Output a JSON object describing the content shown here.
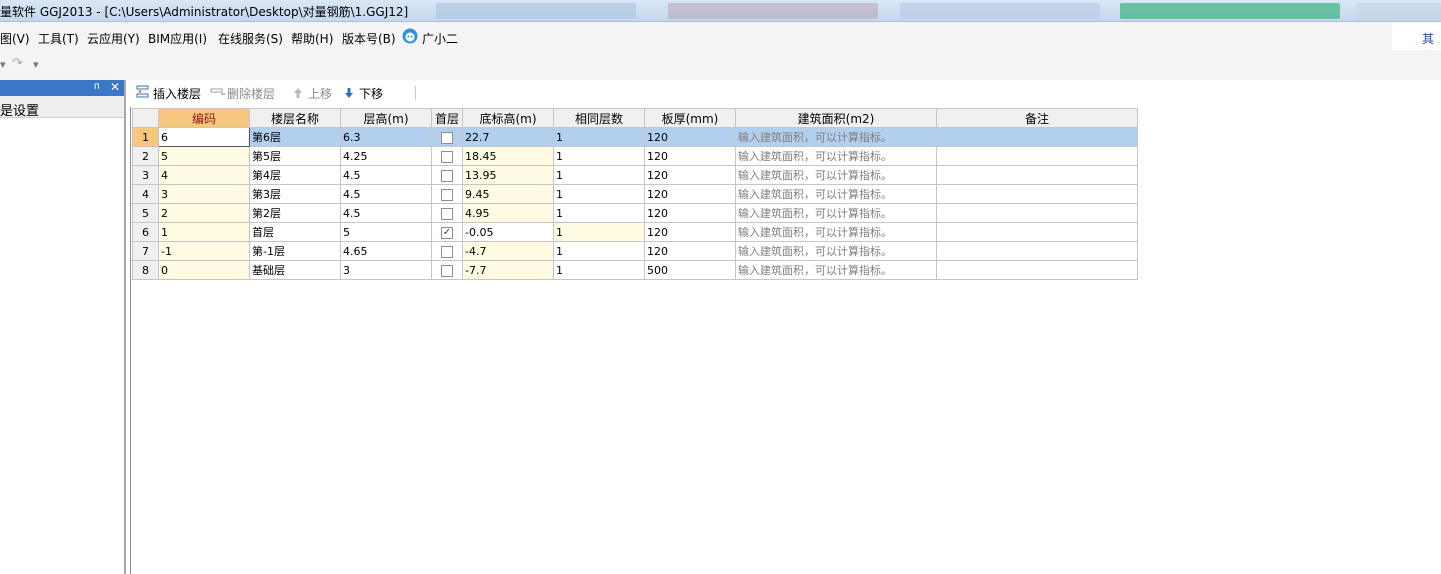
{
  "window": {
    "title": "量软件 GGJ2013 - [C:\\Users\\Administrator\\Desktop\\对量钢筋\\1.GGJ12]"
  },
  "menu": {
    "items": [
      {
        "label": "图(V)"
      },
      {
        "label": "工具(T)"
      },
      {
        "label": "云应用(Y)"
      },
      {
        "label": "BIM应用(I)"
      },
      {
        "label": "在线服务(S)"
      },
      {
        "label": "帮助(H)"
      },
      {
        "label": "版本号(B)"
      },
      {
        "label": "广小二"
      }
    ],
    "right_label": "其它"
  },
  "left_panel": {
    "tab_label": "是设置"
  },
  "toolbar": {
    "insert_floor": "插入楼层",
    "delete_floor": "删除楼层",
    "move_up": "上移",
    "move_down": "下移"
  },
  "grid": {
    "headers": [
      "编码",
      "楼层名称",
      "层高(m)",
      "首层",
      "底标高(m)",
      "相同层数",
      "板厚(mm)",
      "建筑面积(m2)",
      "备注"
    ],
    "rows": [
      {
        "num": "1",
        "code": "6",
        "name": "第6层",
        "height": "6.3",
        "first": false,
        "bottom": "22.7",
        "same": "1",
        "thick": "120",
        "area": "输入建筑面积，可以计算指标。",
        "note": ""
      },
      {
        "num": "2",
        "code": "5",
        "name": "第5层",
        "height": "4.25",
        "first": false,
        "bottom": "18.45",
        "same": "1",
        "thick": "120",
        "area": "输入建筑面积，可以计算指标。",
        "note": ""
      },
      {
        "num": "3",
        "code": "4",
        "name": "第4层",
        "height": "4.5",
        "first": false,
        "bottom": "13.95",
        "same": "1",
        "thick": "120",
        "area": "输入建筑面积，可以计算指标。",
        "note": ""
      },
      {
        "num": "4",
        "code": "3",
        "name": "第3层",
        "height": "4.5",
        "first": false,
        "bottom": "9.45",
        "same": "1",
        "thick": "120",
        "area": "输入建筑面积，可以计算指标。",
        "note": ""
      },
      {
        "num": "5",
        "code": "2",
        "name": "第2层",
        "height": "4.5",
        "first": false,
        "bottom": "4.95",
        "same": "1",
        "thick": "120",
        "area": "输入建筑面积，可以计算指标。",
        "note": ""
      },
      {
        "num": "6",
        "code": "1",
        "name": "首层",
        "height": "5",
        "first": true,
        "bottom": "-0.05",
        "same": "1",
        "thick": "120",
        "area": "输入建筑面积，可以计算指标。",
        "note": ""
      },
      {
        "num": "7",
        "code": "-1",
        "name": "第-1层",
        "height": "4.65",
        "first": false,
        "bottom": "-4.7",
        "same": "1",
        "thick": "120",
        "area": "输入建筑面积，可以计算指标。",
        "note": ""
      },
      {
        "num": "8",
        "code": "0",
        "name": "基础层",
        "height": "3",
        "first": false,
        "bottom": "-7.7",
        "same": "1",
        "thick": "500",
        "area": "输入建筑面积，可以计算指标。",
        "note": ""
      }
    ],
    "selected_row": "1",
    "active_column": "编码"
  },
  "colors": {
    "selection": "#b3cfee",
    "active_header": "#f7c67f",
    "editable_cell": "#fefbe2",
    "panel_header": "#3c77c7"
  }
}
